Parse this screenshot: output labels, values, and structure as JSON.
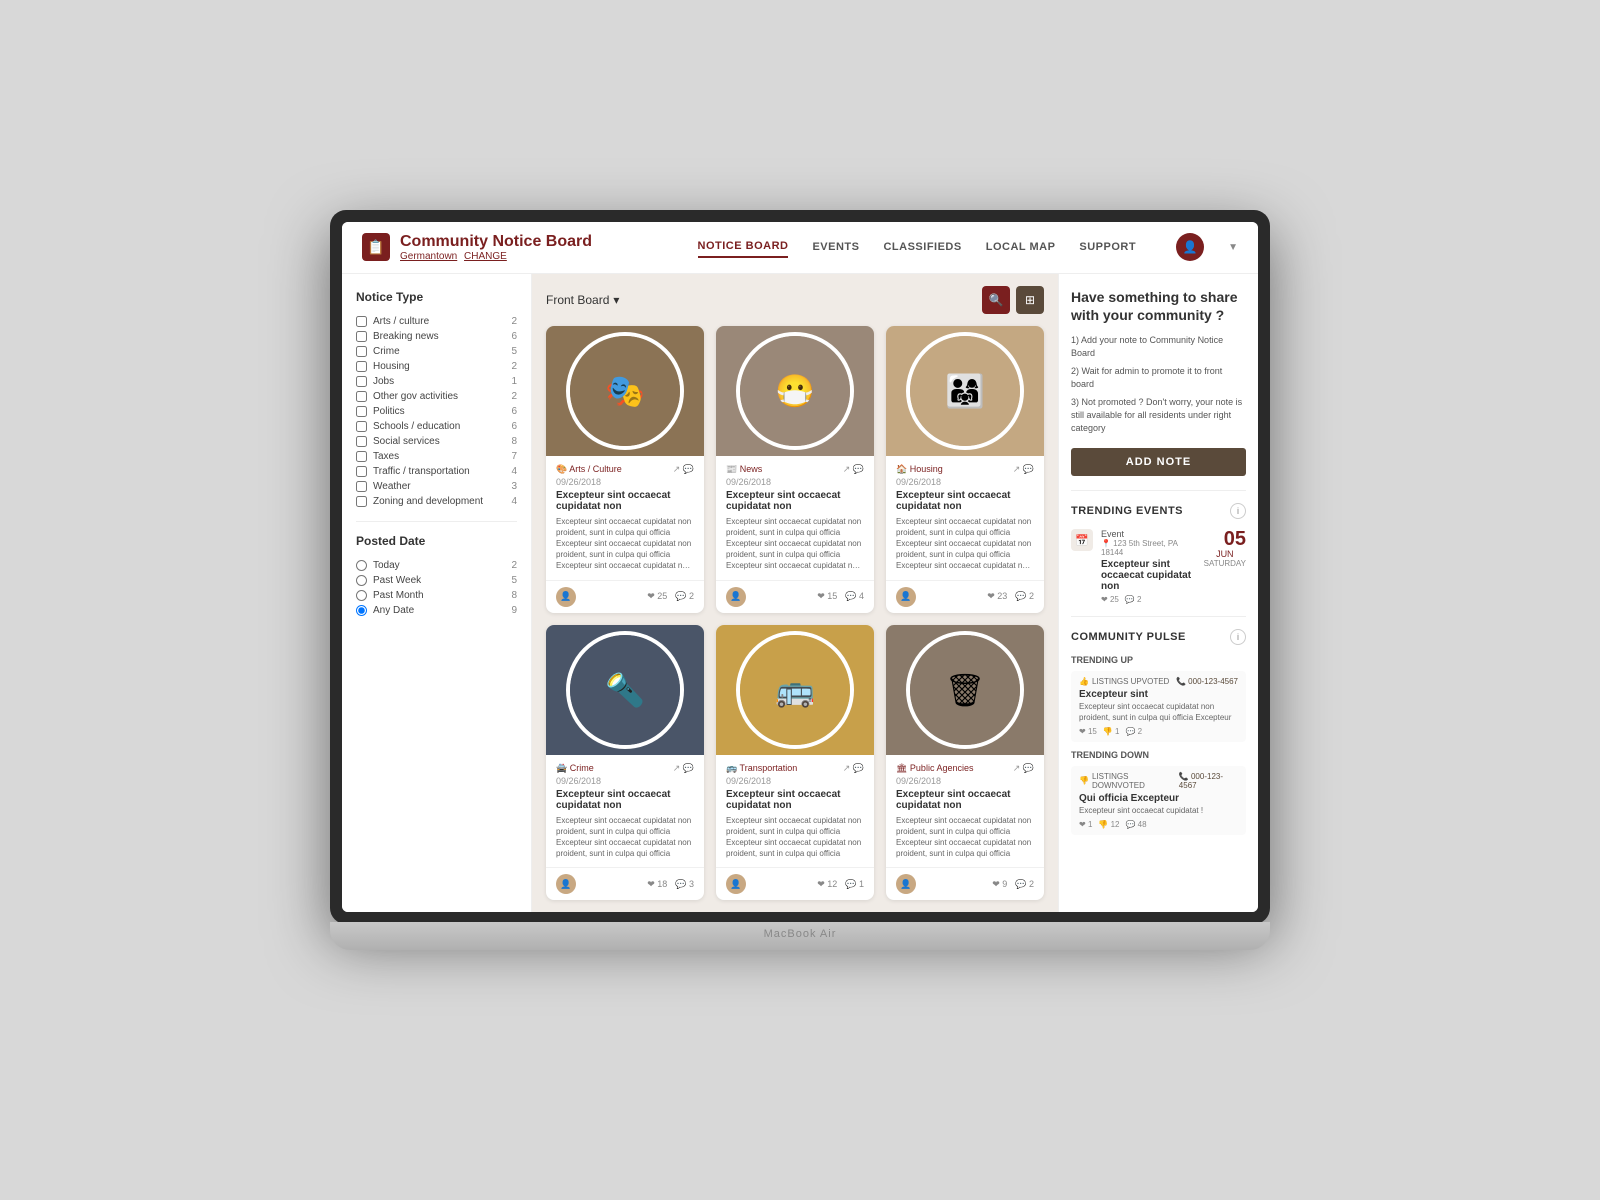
{
  "nav": {
    "logo_title": "Community Notice Board",
    "logo_sub": "Germantown",
    "logo_change": "CHANGE",
    "links": [
      {
        "label": "NOTICE BOARD",
        "active": true
      },
      {
        "label": "EVENTS",
        "active": false
      },
      {
        "label": "CLASSIFIEDS",
        "active": false
      },
      {
        "label": "LOCAL MAP",
        "active": false
      },
      {
        "label": "SUPPORT",
        "active": false
      }
    ]
  },
  "content_header": {
    "board_label": "Front Board",
    "search_icon": "🔍",
    "grid_icon": "⊞"
  },
  "sidebar": {
    "notice_type_title": "Notice Type",
    "filters": [
      {
        "label": "Arts / culture",
        "count": 2
      },
      {
        "label": "Breaking news",
        "count": 6
      },
      {
        "label": "Crime",
        "count": 5
      },
      {
        "label": "Housing",
        "count": 2
      },
      {
        "label": "Jobs",
        "count": 1
      },
      {
        "label": "Other gov activities",
        "count": 2
      },
      {
        "label": "Politics",
        "count": 6
      },
      {
        "label": "Schools / education",
        "count": 6
      },
      {
        "label": "Social services",
        "count": 8
      },
      {
        "label": "Taxes",
        "count": 7
      },
      {
        "label": "Traffic / transportation",
        "count": 4
      },
      {
        "label": "Weather",
        "count": 3
      },
      {
        "label": "Zoning and development",
        "count": 4
      }
    ],
    "posted_date_title": "Posted Date",
    "date_filters": [
      {
        "label": "Today",
        "count": 2,
        "checked": false
      },
      {
        "label": "Past Week",
        "count": 5,
        "checked": false
      },
      {
        "label": "Past Month",
        "count": 8,
        "checked": false
      },
      {
        "label": "Any Date",
        "count": 9,
        "checked": true
      }
    ]
  },
  "cards": [
    {
      "category": "Arts / Culture",
      "category_icon": "🎨",
      "date": "09/26/2018",
      "title": "Excepteur sint occaecat cupidatat non",
      "text": "Excepteur sint occaecat cupidatat non proident, sunt in culpa qui officia Excepteur sint occaecat cupidatat non proident, sunt in culpa qui officia Excepteur sint occaecat cupidatat non proident, sunt in culpa qui officia Excepteur sint occaecat cupidatat non proident, sunt in culpa qui officia",
      "likes": 25,
      "comments": 2,
      "img_color": "#8B7355",
      "img_emoji": "🎨"
    },
    {
      "category": "News",
      "category_icon": "📰",
      "date": "09/26/2018",
      "title": "Excepteur sint occaecat cupidatat non",
      "text": "Excepteur sint occaecat cupidatat non proident, sunt in culpa qui officia Excepteur sint occaecat cupidatat non proident, sunt in culpa qui officia Excepteur sint occaecat cupidatat non proident, sunt in culpa qui officia Excepteur sint occaecat cupidatat non proident",
      "likes": 15,
      "comments": 4,
      "img_color": "#9a8878",
      "img_emoji": "😷"
    },
    {
      "category": "Housing",
      "category_icon": "🏠",
      "date": "09/26/2018",
      "title": "Excepteur sint occaecat cupidatat non",
      "text": "Excepteur sint occaecat cupidatat non proident, sunt in culpa qui officia Excepteur sint occaecat cupidatat non proident, sunt in culpa qui officia Excepteur sint occaecat cupidatat non proident, sunt in culpa qui officia Excepteur sint occaecat cupidatat non proident",
      "likes": 23,
      "comments": 2,
      "img_color": "#c4a882",
      "img_emoji": "🏡"
    },
    {
      "category": "Crime",
      "category_icon": "🚔",
      "date": "09/26/2018",
      "title": "Excepteur sint occaecat cupidatat non",
      "text": "Excepteur sint occaecat cupidatat non proident, sunt in culpa qui officia Excepteur sint occaecat cupidatat non proident, sunt in culpa qui officia",
      "likes": 18,
      "comments": 3,
      "img_color": "#4a5568",
      "img_emoji": "🚨"
    },
    {
      "category": "Transportation",
      "category_icon": "🚌",
      "date": "09/26/2018",
      "title": "Excepteur sint occaecat cupidatat non",
      "text": "Excepteur sint occaecat cupidatat non proident, sunt in culpa qui officia Excepteur sint occaecat cupidatat non proident, sunt in culpa qui officia",
      "likes": 12,
      "comments": 1,
      "img_color": "#c8a04a",
      "img_emoji": "🚌"
    },
    {
      "category": "Public Agencies",
      "category_icon": "🏛",
      "date": "09/26/2018",
      "title": "Excepteur sint occaecat cupidatat non",
      "text": "Excepteur sint occaecat cupidatat non proident, sunt in culpa qui officia Excepteur sint occaecat cupidatat non proident, sunt in culpa qui officia",
      "likes": 9,
      "comments": 2,
      "img_color": "#8a7a6a",
      "img_emoji": "🗑"
    }
  ],
  "right_panel": {
    "share_title": "Have something to share with your community ?",
    "step1": "1) Add your note to Community Notice Board",
    "step2": "2) Wait for admin to promote it to front board",
    "step3": "3) Not promoted ? Don't worry, your note is still available for all residents under right category",
    "add_note_btn": "ADD NOTE",
    "trending_events_title": "TRENDING EVENTS",
    "event": {
      "name": "Event",
      "location": "📍 123 5th Street, PA 18144",
      "title": "Excepteur sint occaecat cupidatat non",
      "day": "05",
      "month": "JUN",
      "weekday": "SATURDAY",
      "likes": 25,
      "comments": 2
    },
    "community_pulse_title": "COMMUNITY PULSE",
    "trending_up_label": "TRENDING UP",
    "trending_up": {
      "badge": "LISTINGS UPVOTED",
      "phone": "000-123-4567",
      "title": "Excepteur sint",
      "text": "Excepteur sint occaecat cupidatat non proident, sunt in culpa qui officia Excepteur",
      "likes": 15,
      "dislikes": 1,
      "comments": 2
    },
    "trending_down_label": "TRENDING DOWN",
    "trending_down": {
      "badge": "LISTINGS DOWNVOTED",
      "phone": "000-123-4567",
      "title": "Qui officia Excepteur",
      "text": "Excepteur sint occaecat cupidatat !",
      "likes": 1,
      "dislikes": 12,
      "comments": 48
    }
  }
}
